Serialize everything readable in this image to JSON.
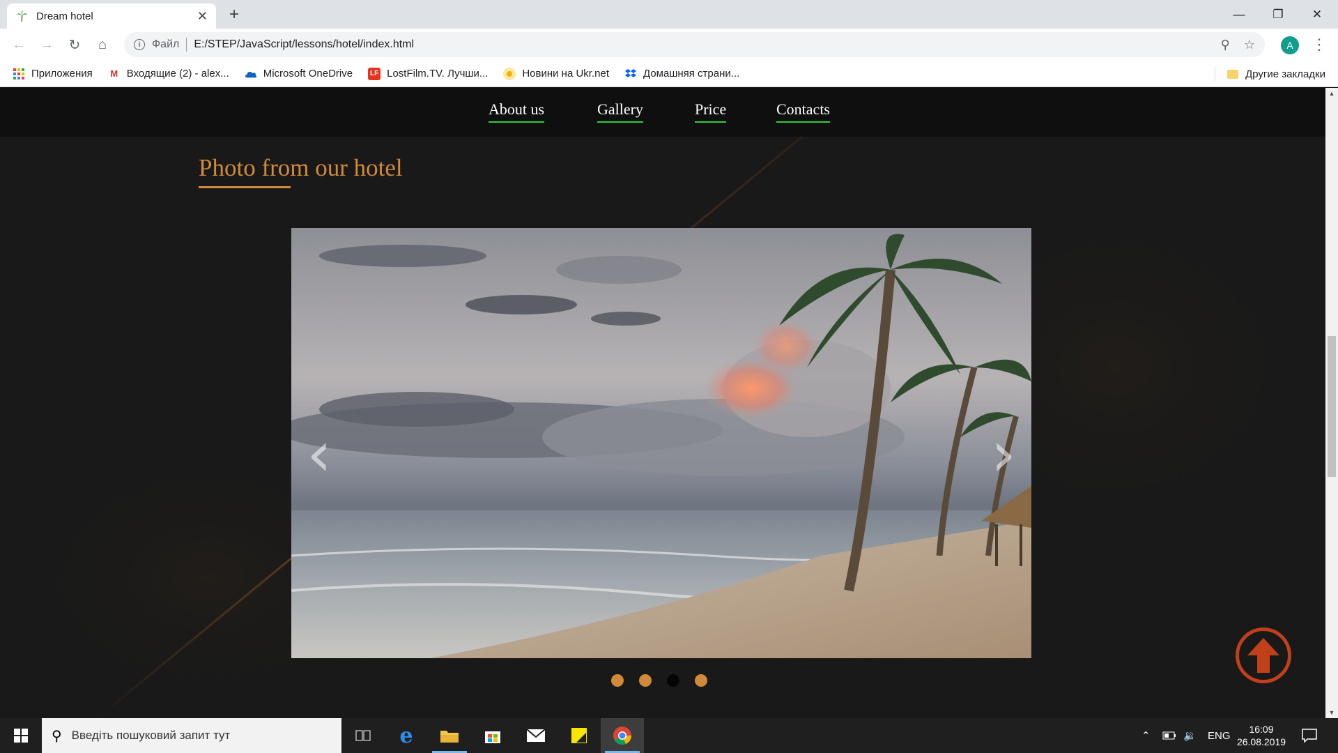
{
  "browser": {
    "tab_title": "Dream hotel",
    "close_tab": "✕",
    "new_tab": "+",
    "address_scheme": "Файл",
    "address_url": "E:/STEP/JavaScript/lessons/hotel/index.html",
    "avatar_letter": "A"
  },
  "bookmarks": {
    "items": [
      {
        "label": "Приложения",
        "icon": "apps-grid-icon"
      },
      {
        "label": "Входящие (2) - alex...",
        "icon": "gmail-icon"
      },
      {
        "label": "Microsoft OneDrive",
        "icon": "onedrive-icon"
      },
      {
        "label": "LostFilm.TV. Лучши...",
        "icon": "lostfilm-icon"
      },
      {
        "label": "Новини на Ukr.net",
        "icon": "ukrnet-icon"
      },
      {
        "label": "Домашняя страни...",
        "icon": "dropbox-icon"
      }
    ],
    "other": "Другие закладки"
  },
  "site": {
    "nav": [
      "About us",
      "Gallery",
      "Price",
      "Contacts"
    ],
    "section_title": "Photo from our hotel",
    "carousel": {
      "slide_count": 4,
      "active_index": 2,
      "prev_symbol": "‹",
      "next_symbol": "›"
    }
  },
  "colors": {
    "accent": "#d08a3a",
    "nav_underline": "#2fcf3c",
    "to_top": "#c0401a",
    "page_bg": "#191919"
  },
  "taskbar": {
    "search_placeholder": "Введіть пошуковий запит тут",
    "language": "ENG",
    "time": "16:09",
    "date": "26.08.2019"
  }
}
